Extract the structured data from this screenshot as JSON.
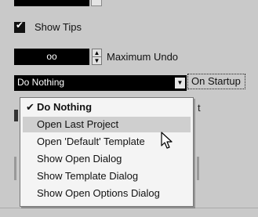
{
  "show_tips": {
    "label": "Show Tips",
    "checked": true
  },
  "undo": {
    "value": "oo",
    "label": "Maximum Undo"
  },
  "startup": {
    "selected": "Do Nothing",
    "label": "On Startup",
    "options": [
      {
        "label": "Do Nothing",
        "selected": true
      },
      {
        "label": "Open Last Project",
        "hovered": true
      },
      {
        "label": "Open 'Default' Template"
      },
      {
        "label": "Show Open Dialog"
      },
      {
        "label": "Show Template Dialog"
      },
      {
        "label": "Show Open Options Dialog"
      }
    ]
  },
  "partial_text": "t",
  "icons": {
    "check": "checkmark-icon",
    "dropdown": "chevron-down-icon",
    "cursor": "mouse-pointer-icon"
  }
}
